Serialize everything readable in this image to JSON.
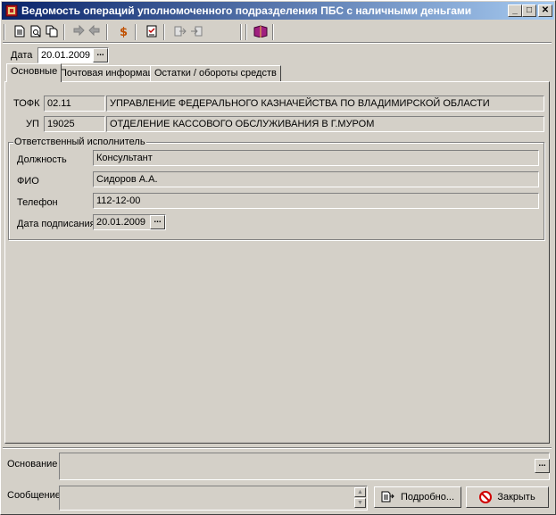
{
  "window": {
    "title": "Ведомость операций уполномоченного подразделения ПБС с наличными деньгами",
    "minimize_label": "_",
    "maximize_label": "□",
    "close_label": "✕"
  },
  "toolbar": {
    "buttons": [
      "new-doc-icon",
      "preview-icon",
      "copy-doc-icon",
      "forward-icon",
      "back-icon",
      "money-icon",
      "checklist-icon",
      "export-icon",
      "import-icon",
      "book-icon"
    ]
  },
  "date": {
    "label": "Дата",
    "value": "20.01.2009",
    "button": "..."
  },
  "tabs": [
    {
      "label": "Основные",
      "active": true
    },
    {
      "label": "Почтовая информация",
      "active": false
    },
    {
      "label": "Остатки / обороты средств",
      "active": false
    }
  ],
  "main": {
    "tofk": {
      "label": "ТОФК",
      "code": "02.11",
      "name": "УПРАВЛЕНИЕ ФЕДЕРАЛЬНОГО КАЗНАЧЕЙСТВА ПО ВЛАДИМИРСКОЙ ОБЛАСТИ"
    },
    "up": {
      "label": "УП",
      "code": "19025",
      "name": "ОТДЕЛЕНИЕ КАССОВОГО ОБСЛУЖИВАНИЯ В Г.МУРОМ"
    },
    "executor": {
      "title": "Ответственный исполнитель",
      "position_label": "Должность",
      "position_value": "Консультант",
      "fio_label": "ФИО",
      "fio_value": "Сидоров А.А.",
      "phone_label": "Телефон",
      "phone_value": "112-12-00",
      "sign_date_label": "Дата подписания",
      "sign_date_value": "20.01.2009",
      "sign_date_button": "..."
    }
  },
  "bottom": {
    "basis_label": "Основание",
    "basis_value": "",
    "basis_button": "...",
    "message_label": "Сообщение",
    "message_value": "",
    "scroll_up": "▲",
    "scroll_down": "▼",
    "details_button": "Подробно...",
    "close_button": "Закрыть"
  }
}
